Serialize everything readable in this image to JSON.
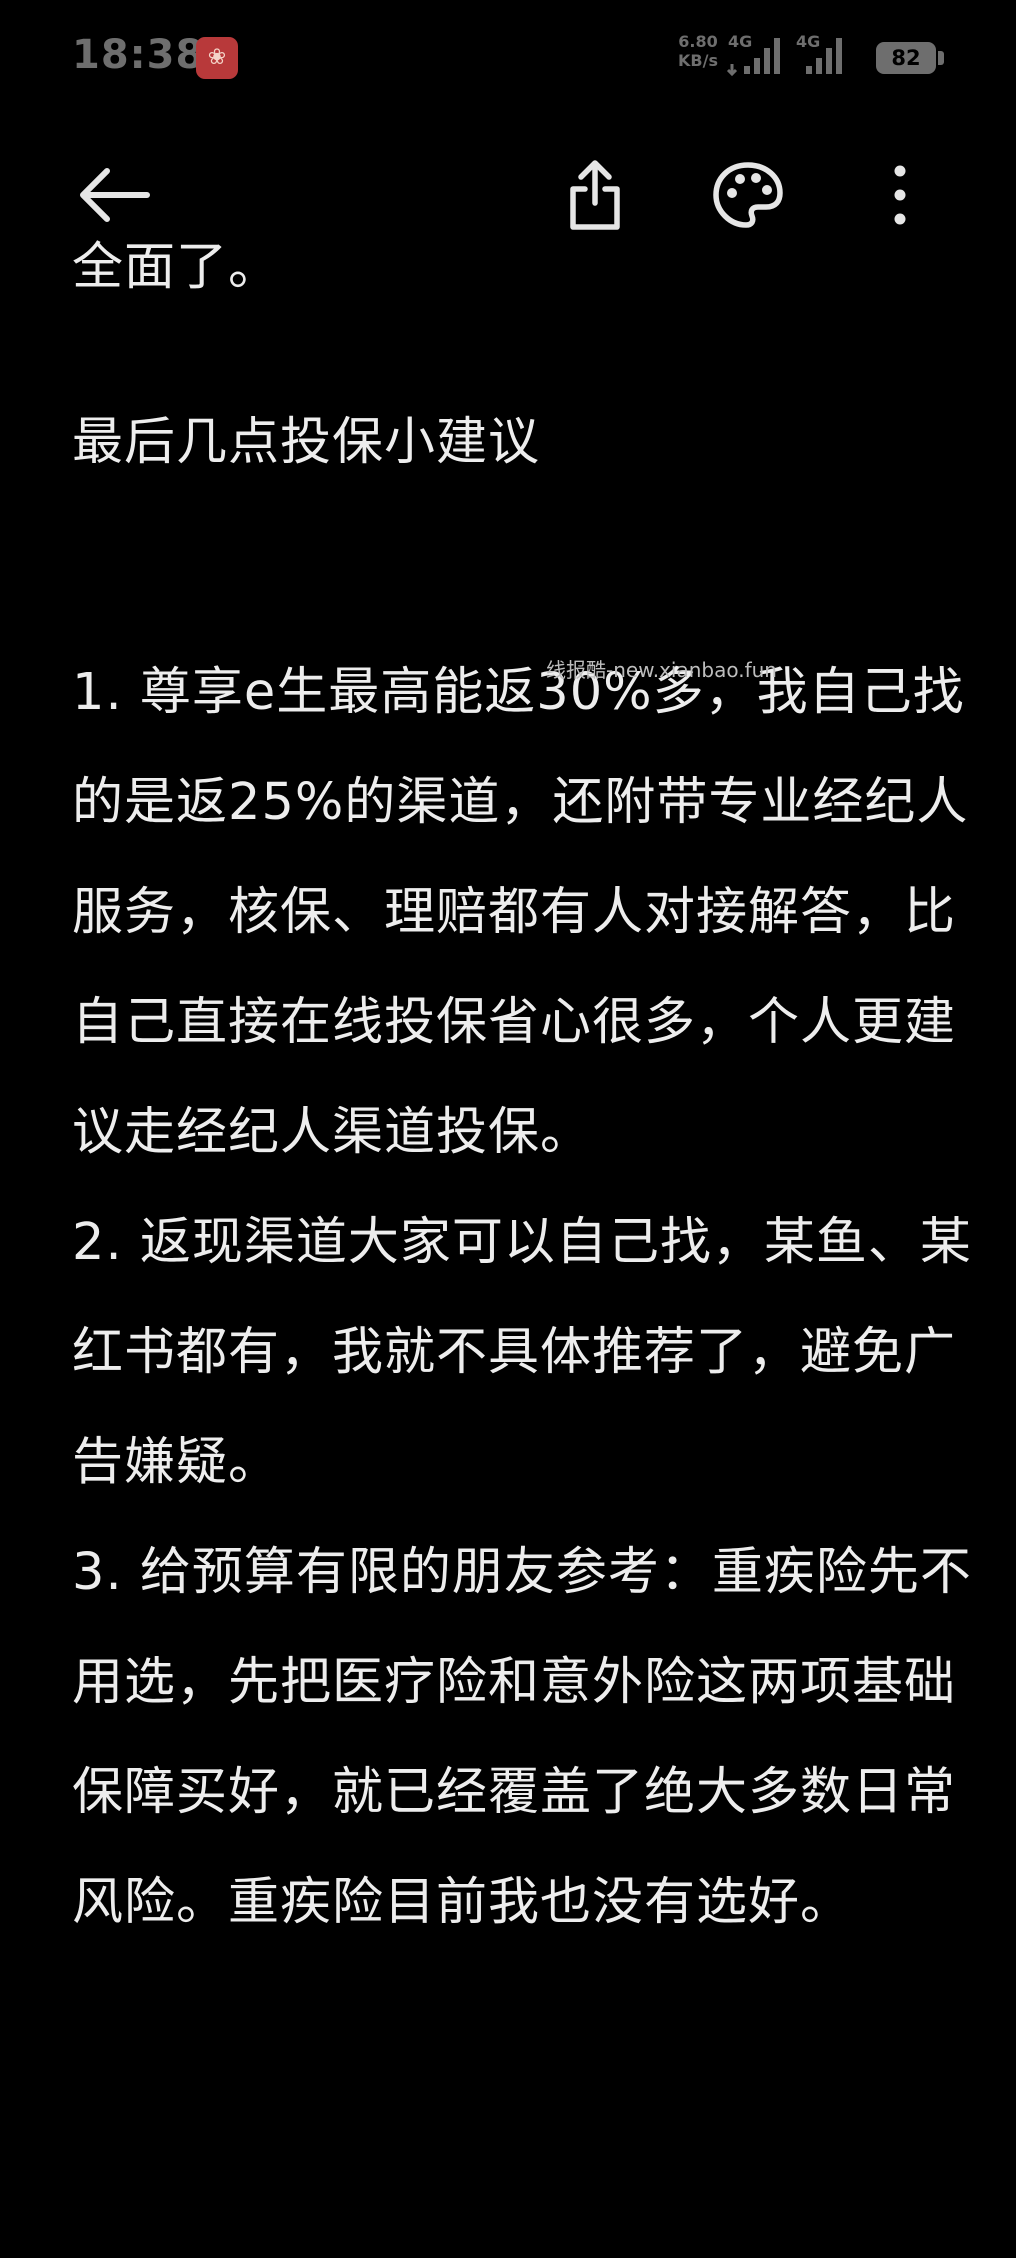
{
  "status_bar": {
    "time": "18:38",
    "app_icon_glyph": "❀",
    "net_speed_value": "6.80",
    "net_speed_unit": "KB/s",
    "signal_1_label": "4G",
    "signal_2_label": "4G",
    "battery_level": "82"
  },
  "toolbar": {
    "back_icon": "arrow-left-icon",
    "share_icon": "share-icon",
    "theme_icon": "palette-icon",
    "more_icon": "more-vertical-icon"
  },
  "article": {
    "partial_line": "全面了。",
    "heading": "最后几点投保小建议",
    "watermark": "线报酷-new.xianbao.fun",
    "paragraphs": [
      "1. 尊享e生最高能返30%多，我自己找的是返25%的渠道，还附带专业经纪人服务，核保、理赔都有人对接解答，比自己直接在线投保省心很多，个人更建议走经纪人渠道投保。",
      "2. 返现渠道大家可以自己找，某鱼、某红书都有，我就不具体推荐了，避免广告嫌疑。",
      "3. 给预算有限的朋友参考：重疾险先不用选，先把医疗险和意外险这两项基础保障买好，就已经覆盖了绝大多数日常风险。重疾险目前我也没有选好。"
    ]
  },
  "colors": {
    "background": "#000000",
    "text": "#EDEDED",
    "status_gray": "#6E6E6E",
    "icon": "#E6E6E6"
  }
}
